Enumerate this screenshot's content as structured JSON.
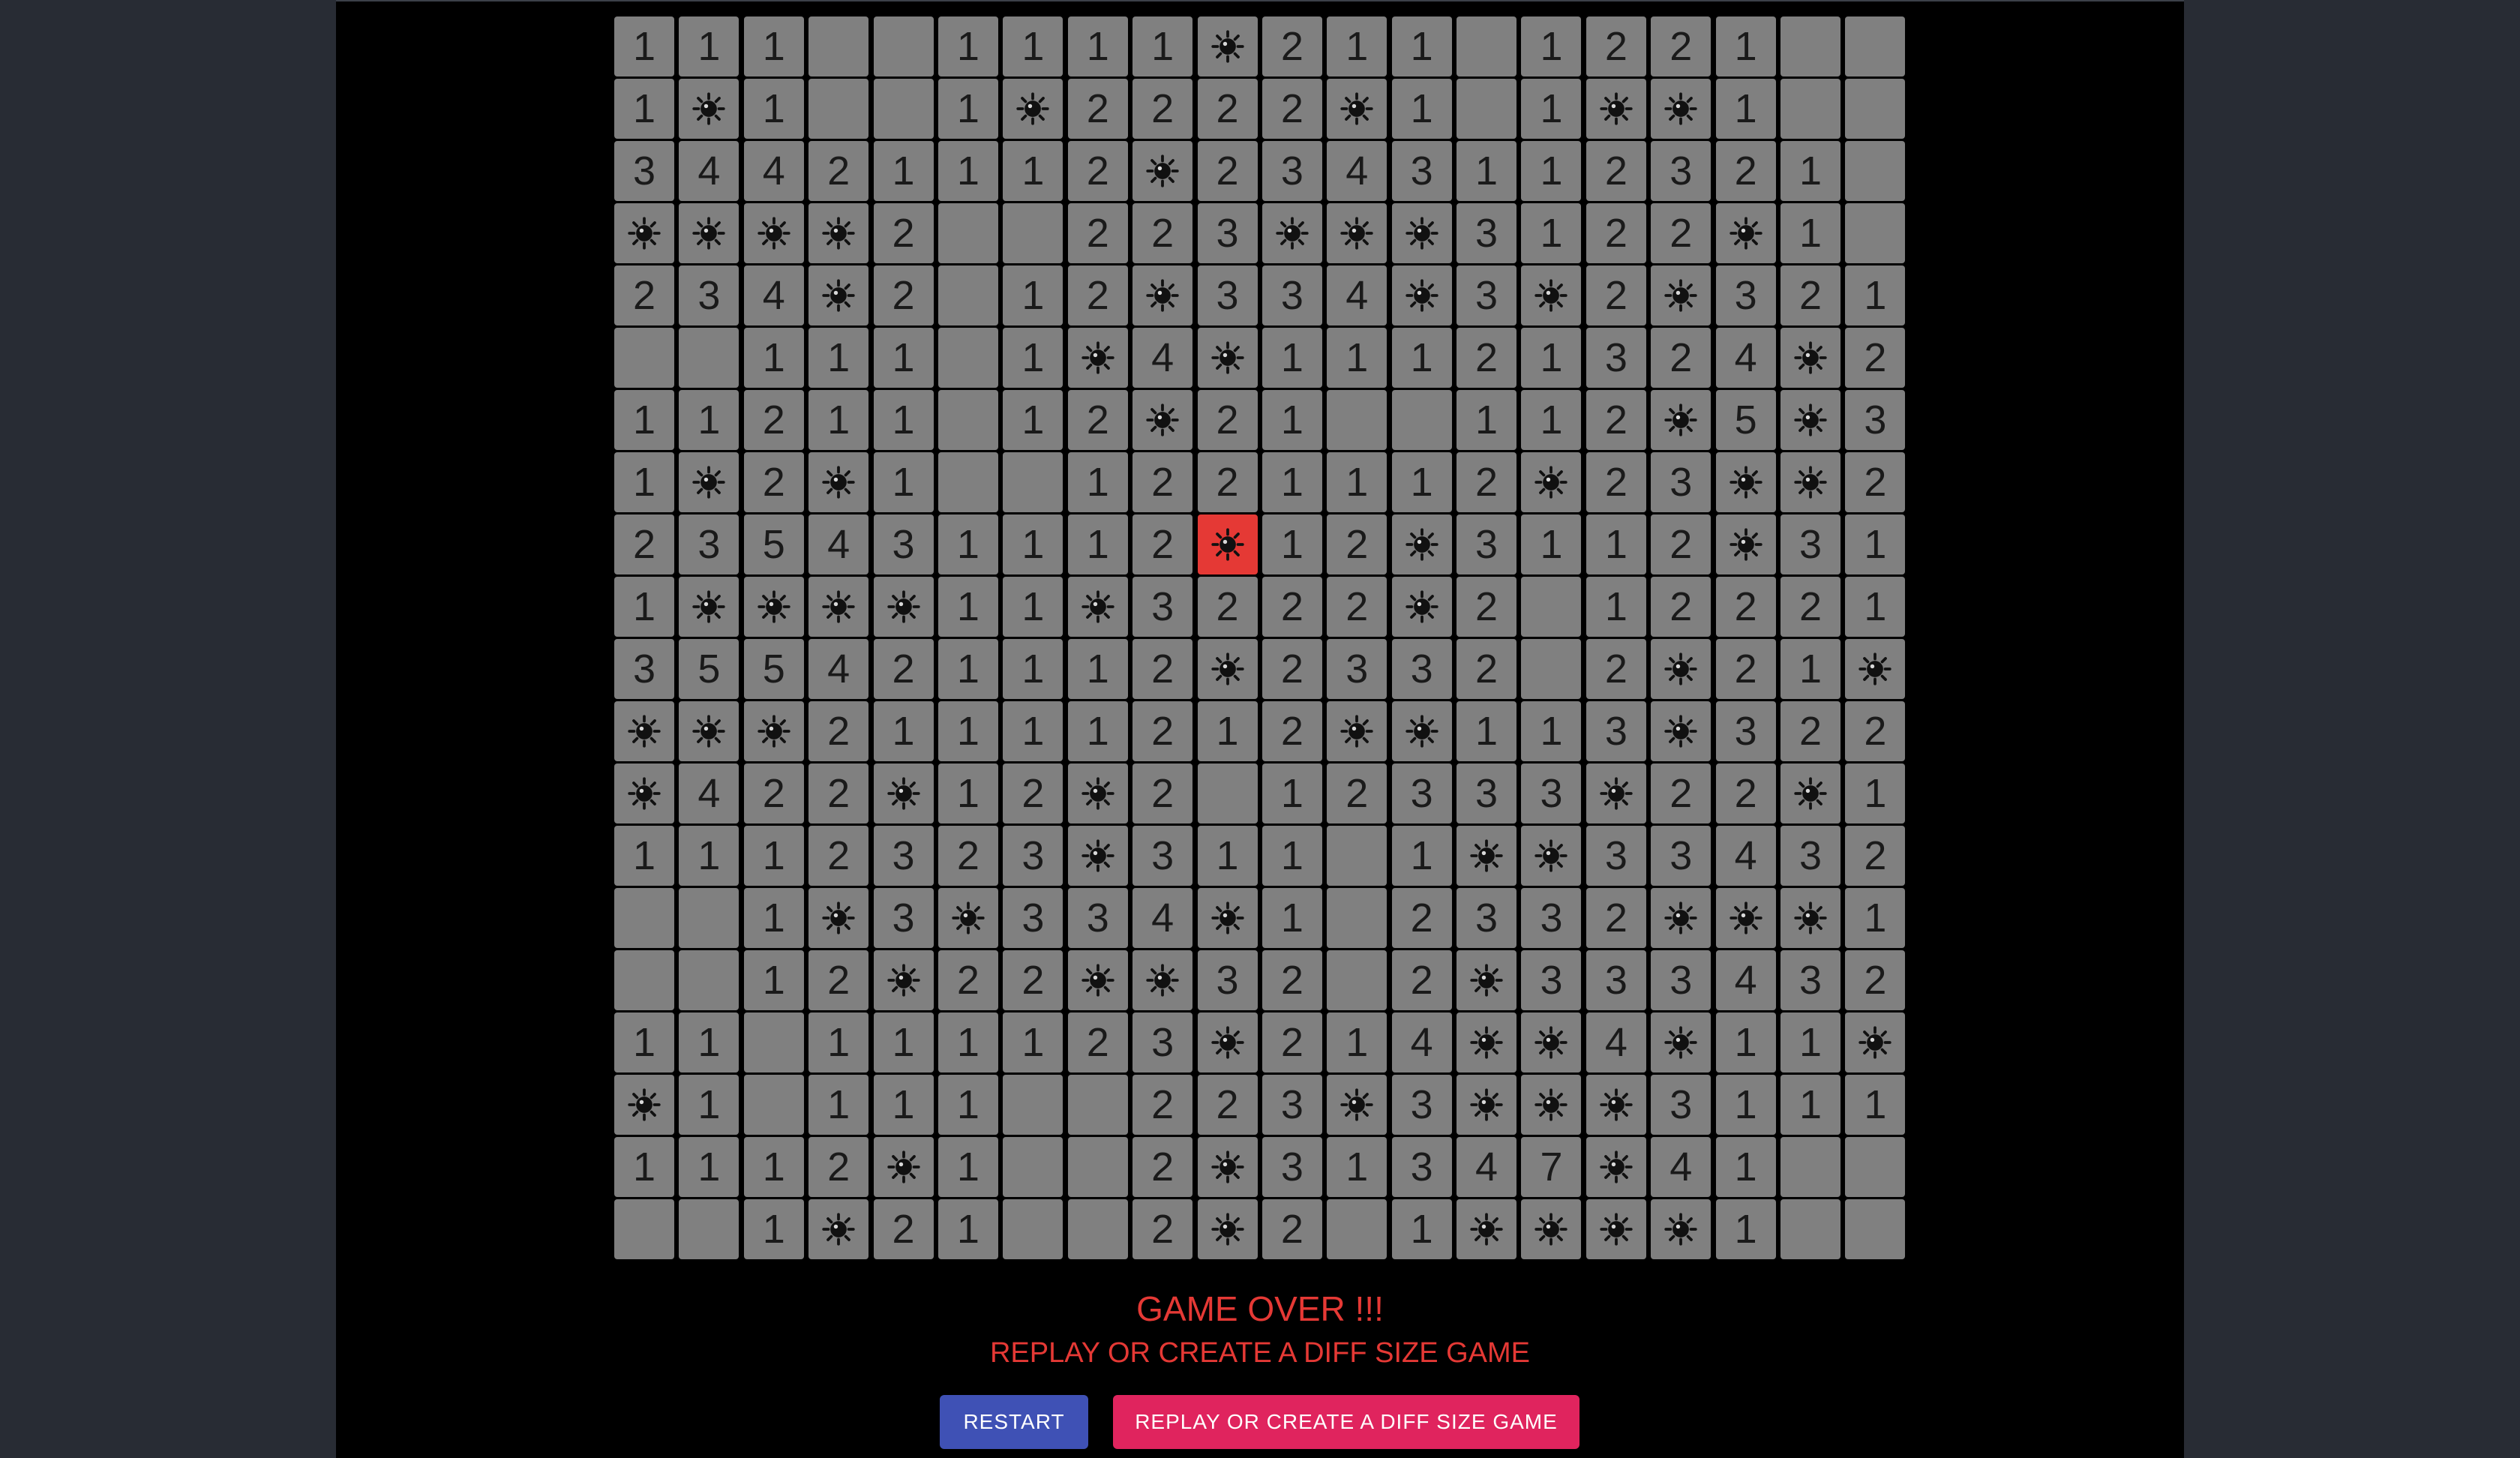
{
  "board": {
    "rows": [
      [
        "1",
        "1",
        "1",
        "",
        "",
        "1",
        "1",
        "1",
        "1",
        "*",
        "2",
        "1",
        "1",
        "",
        "1",
        "2",
        "2",
        "1",
        "",
        ""
      ],
      [
        "1",
        "*",
        "1",
        "",
        "",
        "1",
        "*",
        "2",
        "2",
        "2",
        "2",
        "*",
        "1",
        "",
        "1",
        "*",
        "*",
        "1",
        "",
        ""
      ],
      [
        "3",
        "4",
        "4",
        "2",
        "1",
        "1",
        "1",
        "2",
        "*",
        "2",
        "3",
        "4",
        "3",
        "1",
        "1",
        "2",
        "3",
        "2",
        "1",
        ""
      ],
      [
        "*",
        "*",
        "*",
        "*",
        "2",
        "",
        "",
        "2",
        "2",
        "3",
        "*",
        "*",
        "*",
        "3",
        "1",
        "2",
        "2",
        "*",
        "1",
        ""
      ],
      [
        "2",
        "3",
        "4",
        "*",
        "2",
        "",
        "1",
        "2",
        "*",
        "3",
        "3",
        "4",
        "*",
        "3",
        "*",
        "2",
        "*",
        "3",
        "2",
        "1"
      ],
      [
        "",
        "",
        "1",
        "1",
        "1",
        "",
        "1",
        "*",
        "4",
        "*",
        "1",
        "1",
        "1",
        "2",
        "1",
        "3",
        "2",
        "4",
        "*",
        "2"
      ],
      [
        "1",
        "1",
        "2",
        "1",
        "1",
        "",
        "1",
        "2",
        "*",
        "2",
        "1",
        "",
        "",
        "1",
        "1",
        "2",
        "*",
        "5",
        "*",
        "3"
      ],
      [
        "1",
        "*",
        "2",
        "*",
        "1",
        "",
        "",
        "1",
        "2",
        "2",
        "1",
        "1",
        "1",
        "2",
        "*",
        "2",
        "3",
        "*",
        "*",
        "2"
      ],
      [
        "2",
        "3",
        "5",
        "4",
        "3",
        "1",
        "1",
        "1",
        "2",
        "X",
        "1",
        "2",
        "*",
        "3",
        "1",
        "1",
        "2",
        "*",
        "3",
        "1"
      ],
      [
        "1",
        "*",
        "*",
        "*",
        "*",
        "1",
        "1",
        "*",
        "3",
        "2",
        "2",
        "2",
        "*",
        "2",
        "",
        "1",
        "2",
        "2",
        "2",
        "1"
      ],
      [
        "3",
        "5",
        "5",
        "4",
        "2",
        "1",
        "1",
        "1",
        "2",
        "*",
        "2",
        "3",
        "3",
        "2",
        "",
        "2",
        "*",
        "2",
        "1",
        "*"
      ],
      [
        "*",
        "*",
        "*",
        "2",
        "1",
        "1",
        "1",
        "1",
        "2",
        "1",
        "2",
        "*",
        "*",
        "1",
        "1",
        "3",
        "*",
        "3",
        "2",
        "2"
      ],
      [
        "*",
        "4",
        "2",
        "2",
        "*",
        "1",
        "2",
        "*",
        "2",
        "",
        "1",
        "2",
        "3",
        "3",
        "3",
        "*",
        "2",
        "2",
        "*",
        "1"
      ],
      [
        "1",
        "1",
        "1",
        "2",
        "3",
        "2",
        "3",
        "*",
        "3",
        "1",
        "1",
        "",
        "1",
        "*",
        "*",
        "3",
        "3",
        "4",
        "3",
        "2"
      ],
      [
        "",
        "",
        "1",
        "*",
        "3",
        "*",
        "3",
        "3",
        "4",
        "*",
        "1",
        "",
        "2",
        "3",
        "3",
        "2",
        "*",
        "*",
        "*",
        "1"
      ],
      [
        "",
        "",
        "1",
        "2",
        "*",
        "2",
        "2",
        "*",
        "*",
        "3",
        "2",
        "",
        "2",
        "*",
        "3",
        "3",
        "3",
        "4",
        "3",
        "2"
      ],
      [
        "1",
        "1",
        "",
        "1",
        "1",
        "1",
        "1",
        "2",
        "3",
        "*",
        "2",
        "1",
        "4",
        "*",
        "*",
        "4",
        "*",
        "1",
        "1",
        "*"
      ],
      [
        "*",
        "1",
        "",
        "1",
        "1",
        "1",
        "",
        "",
        "2",
        "2",
        "3",
        "*",
        "3",
        "*",
        "*",
        "*",
        "3",
        "1",
        "1",
        "1"
      ],
      [
        "1",
        "1",
        "1",
        "2",
        "*",
        "1",
        "",
        "",
        "2",
        "*",
        "3",
        "1",
        "3",
        "4",
        "7",
        "*",
        "4",
        "1",
        "",
        ""
      ],
      [
        "",
        "",
        "1",
        "*",
        "2",
        "1",
        "",
        "",
        "2",
        "*",
        "2",
        "",
        "1",
        "*",
        "*",
        "*",
        "*",
        "1",
        "",
        ""
      ]
    ]
  },
  "status": {
    "title": "GAME OVER !!!",
    "subtitle": "REPLAY OR CREATE A DIFF SIZE GAME"
  },
  "buttons": {
    "restart": "RESTART",
    "replay": "REPLAY OR CREATE A DIFF SIZE GAME"
  },
  "colors": {
    "cell": "#808080",
    "exploded": "#e53935",
    "message": "#e53935",
    "restart_button": "#3f51b5",
    "replay_button": "#e0245e"
  },
  "icons": {
    "mine": "mine-icon"
  }
}
